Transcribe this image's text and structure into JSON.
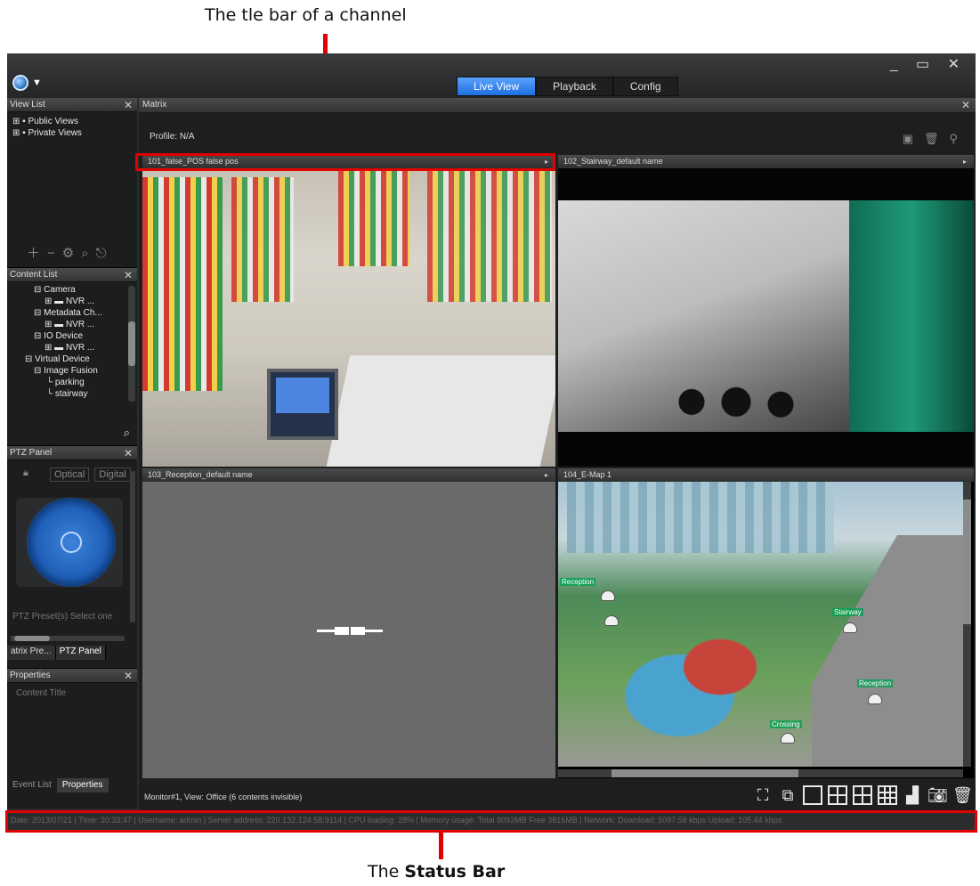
{
  "annotations": {
    "title_bar_caption": "The tle bar of a channel",
    "status_bar_caption_prefix": "The",
    "status_bar_caption_bold": "Status Bar"
  },
  "window": {
    "tabs": [
      {
        "label": "Live View",
        "active": true
      },
      {
        "label": "Playback",
        "active": false
      },
      {
        "label": "Config",
        "active": false
      }
    ],
    "controls": "_ ▭ ✕"
  },
  "view_list": {
    "title": "View List",
    "items": [
      "Public Views",
      "Private Views"
    ]
  },
  "content_list": {
    "title": "Content List",
    "items": [
      "Camera",
      "NVR ...",
      "Metadata Ch...",
      "NVR ...",
      "IO Device",
      "NVR ...",
      "Virtual Device",
      "Image Fusion",
      "parking",
      "stairway"
    ]
  },
  "ptz_panel": {
    "title": "PTZ Panel",
    "optical": "Optical",
    "digital": "Digital",
    "presets": "PTZ Preset(s)",
    "select": "Select one",
    "tab_left": "atrix Pre...",
    "tab_right": "PTZ Panel"
  },
  "properties": {
    "title": "Properties",
    "content_title": "Content Title",
    "tab_event": "Event List",
    "tab_properties": "Properties"
  },
  "matrix": {
    "title": "Matrix",
    "profile": "Profile: N/A",
    "channels": [
      {
        "title": "101_false_POS false pos"
      },
      {
        "title": "102_Stairway_default name"
      },
      {
        "title": "103_Reception_default name"
      },
      {
        "title": "104_E-Map 1"
      }
    ],
    "map_labels": [
      "Reception",
      "Stairway",
      "Reception",
      "Crossing"
    ],
    "monitor_info": "Monitor#1, View: Office (6 contents invisible)"
  },
  "status_bar": {
    "text": "Date: 2013/07/21  |  Time: 20:33:47  |  Username: admin  |  Server address: 220.132.124.58:9114  |  CPU loading: 28%  |  Memory usage: Total 8092MB Free 3816MB  |  Network: Download: 5097.58 kbps Upload: 105.44 kbps"
  },
  "colors": {
    "accent": "#1d6ee0",
    "annotation": "#e00000"
  }
}
